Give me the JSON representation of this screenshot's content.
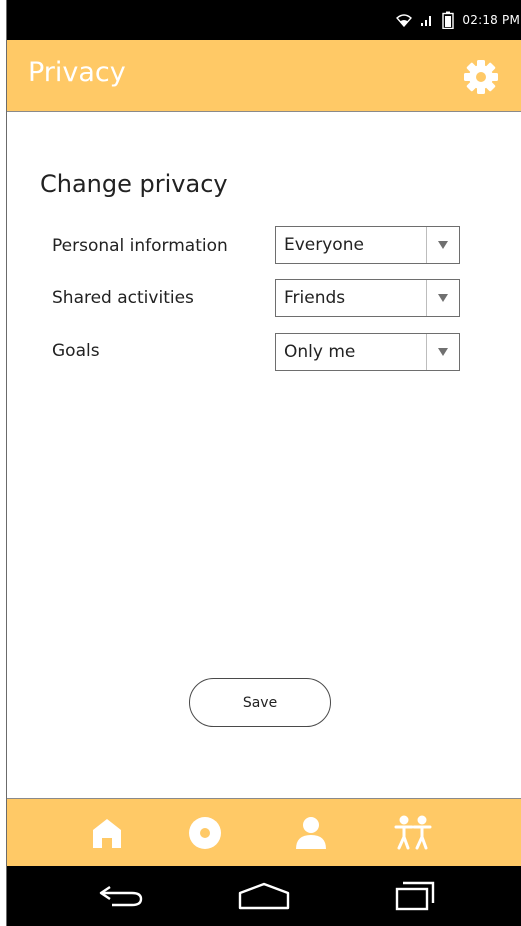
{
  "status_bar": {
    "time": "02:18 PM",
    "icons": [
      "wifi-icon",
      "signal-icon",
      "battery-icon"
    ]
  },
  "app_bar": {
    "title": "Privacy",
    "settings_icon": "gear-icon"
  },
  "privacy": {
    "heading": "Change privacy",
    "rows": [
      {
        "label": "Personal information",
        "value": "Everyone"
      },
      {
        "label": "Shared activities",
        "value": "Friends"
      },
      {
        "label": "Goals",
        "value": "Only me"
      }
    ]
  },
  "save_label": "Save",
  "bottom_nav": {
    "items": [
      "home-icon",
      "circle-icon",
      "person-icon",
      "people-icon"
    ]
  },
  "system_nav": {
    "items": [
      "back-icon",
      "home-outline-icon",
      "recents-icon"
    ]
  },
  "colors": {
    "accent": "#ffc966",
    "bar_dark": "#000000",
    "text": "#222222"
  }
}
